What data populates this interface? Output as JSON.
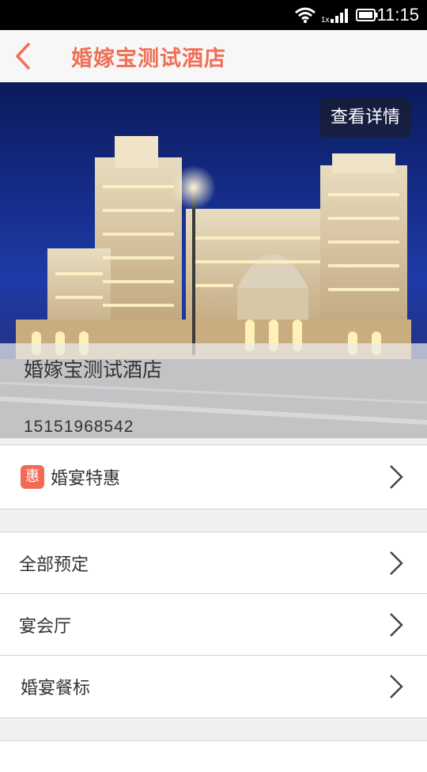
{
  "status_bar": {
    "time": "11:15",
    "network_label": "1x"
  },
  "nav": {
    "title": "婚嫁宝测试酒店"
  },
  "hero": {
    "detail_button": "查看详情",
    "hotel_name": "婚嫁宝测试酒店",
    "phone": "15151968542"
  },
  "menu": {
    "promo": {
      "badge": "惠",
      "label": "婚宴特惠"
    },
    "items": [
      {
        "label": "全部预定"
      },
      {
        "label": "宴会厅"
      },
      {
        "label": "婚宴餐标"
      }
    ]
  },
  "colors": {
    "accent": "#f06f56",
    "badge": "#f16a55"
  }
}
